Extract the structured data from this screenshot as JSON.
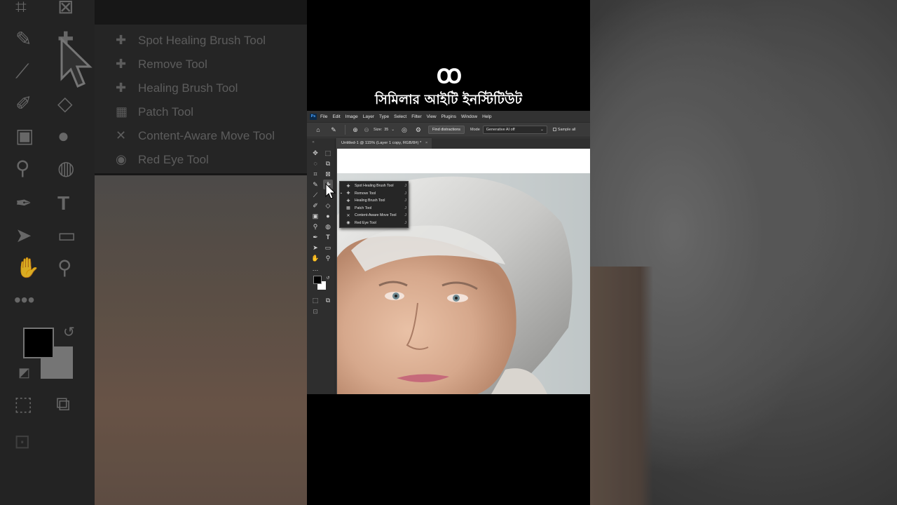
{
  "brand": {
    "logo_mark": "ꝏ",
    "name": "সিমিলার আইটি ইনস্টিটিউট"
  },
  "photoshop": {
    "app_badge": "Ps",
    "menu": [
      "File",
      "Edit",
      "Image",
      "Layer",
      "Type",
      "Select",
      "Filter",
      "View",
      "Plugins",
      "Window",
      "Help"
    ],
    "options": {
      "size_label": "Size:",
      "size_value": "35",
      "find_distractions": "Find distractions",
      "mode_label": "Mode",
      "mode_value": "Generative AI off",
      "sample_all": "Sample all"
    },
    "document_tab": "Untitled-1 @ 115% (Layer 1 copy, RGB/8#) *",
    "flyout": [
      {
        "label": "Spot Healing Brush Tool",
        "shortcut": "J",
        "icon": "bandage-icon"
      },
      {
        "label": "Remove Tool",
        "shortcut": "J",
        "icon": "remove-icon"
      },
      {
        "label": "Healing Brush Tool",
        "shortcut": "J",
        "icon": "bandage-icon"
      },
      {
        "label": "Patch Tool",
        "shortcut": "J",
        "icon": "patch-icon"
      },
      {
        "label": "Content-Aware Move Tool",
        "shortcut": "J",
        "icon": "move-arrows-icon"
      },
      {
        "label": "Red Eye Tool",
        "shortcut": "J",
        "icon": "eye-icon"
      }
    ]
  },
  "backdrop_flyout": [
    "Spot Healing Brush Tool",
    "Remove Tool",
    "Healing Brush Tool",
    "Patch Tool",
    "Content-Aware Move Tool",
    "Red Eye Tool"
  ]
}
